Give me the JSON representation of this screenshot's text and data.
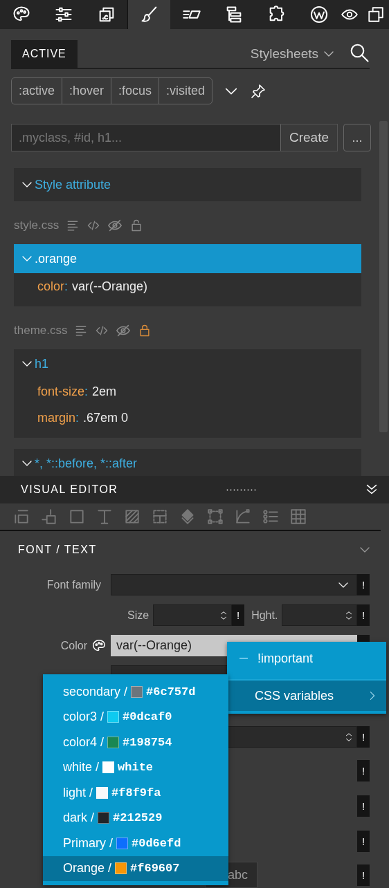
{
  "toolbar": {
    "tabs": [
      {
        "selected": false
      },
      {
        "selected": false
      },
      {
        "selected": false
      },
      {
        "selected": true
      },
      {
        "selected": false
      },
      {
        "selected": false
      },
      {
        "selected": false
      },
      {
        "selected": false
      }
    ]
  },
  "panel": {
    "tab": "ACTIVE",
    "sources": "Stylesheets"
  },
  "pseudo_states": [
    {
      "label": ":active",
      "selected": false
    },
    {
      "label": ":hover",
      "selected": false
    },
    {
      "label": ":focus",
      "selected": false
    },
    {
      "label": ":visited",
      "selected": false
    }
  ],
  "selector_input": {
    "placeholder": ".myclass, #id, h1..."
  },
  "create_button": "Create",
  "more_button": "...",
  "style_attribute": {
    "label": "Style attribute",
    "expanded": true
  },
  "stylesheets": [
    {
      "name": "style.css",
      "locked": false,
      "rules": [
        {
          "selector": ".orange",
          "selected": true,
          "expanded": true,
          "properties": [
            {
              "name": "color",
              "separator": ":",
              "value": "var(--Orange)"
            }
          ]
        }
      ]
    },
    {
      "name": "theme.css",
      "locked": true,
      "rules": [
        {
          "selector": "h1",
          "selected": false,
          "expanded": true,
          "properties": [
            {
              "name": "font-size",
              "separator": ":",
              "value": "2em"
            },
            {
              "name": "margin",
              "separator": ":",
              "value": ".67em 0"
            }
          ]
        },
        {
          "selector": "*, *::before, *::after",
          "selected": false,
          "expanded": true
        }
      ]
    }
  ],
  "visual_editor": {
    "title": "VISUAL EDITOR"
  },
  "section": {
    "title": "FONT / TEXT",
    "expanded": true
  },
  "fields": [
    {
      "kind": "select",
      "label": "Font family",
      "flag": "!"
    },
    {
      "kind": "pair",
      "items": [
        {
          "label": "Size",
          "flag": "!"
        },
        {
          "label": "Hght.",
          "flag": "!"
        }
      ]
    },
    {
      "kind": "color",
      "label": "Color",
      "value": "var(--Orange)"
    },
    {
      "kind": "weight"
    },
    {
      "kind": "spinner",
      "flag": "!"
    },
    {
      "kind": "flag",
      "flag": "!"
    },
    {
      "kind": "flag",
      "flag": "!"
    },
    {
      "kind": "flag",
      "flag": "!"
    },
    {
      "kind": "text",
      "placeholder": "abc",
      "flag": "!"
    }
  ],
  "context_menu": {
    "items": [
      {
        "kind": "action",
        "label": "!important",
        "selected": false
      },
      {
        "kind": "submenu",
        "label": "CSS variables",
        "selected": true
      }
    ]
  },
  "variables_menu": {
    "items": [
      {
        "label": "secondary /",
        "value": "#6c757d",
        "color": "#6c757d",
        "selected": false
      },
      {
        "label": "color3 /",
        "value": "#0dcaf0",
        "color": "#0dcaf0",
        "selected": false
      },
      {
        "label": "color4 /",
        "value": "#198754",
        "color": "#198754",
        "selected": false
      },
      {
        "label": "white /",
        "value": "white",
        "color": "#ffffff",
        "selected": false
      },
      {
        "label": "light /",
        "value": "#f8f9fa",
        "color": "#f8f9fa",
        "selected": false
      },
      {
        "label": "dark /",
        "value": "#212529",
        "color": "#212529",
        "selected": false
      },
      {
        "label": "Primary /",
        "value": "#0d6efd",
        "color": "#0d6efd",
        "selected": false
      },
      {
        "label": "Orange /",
        "value": "#f69607",
        "color": "#f69607",
        "selected": true
      }
    ]
  }
}
